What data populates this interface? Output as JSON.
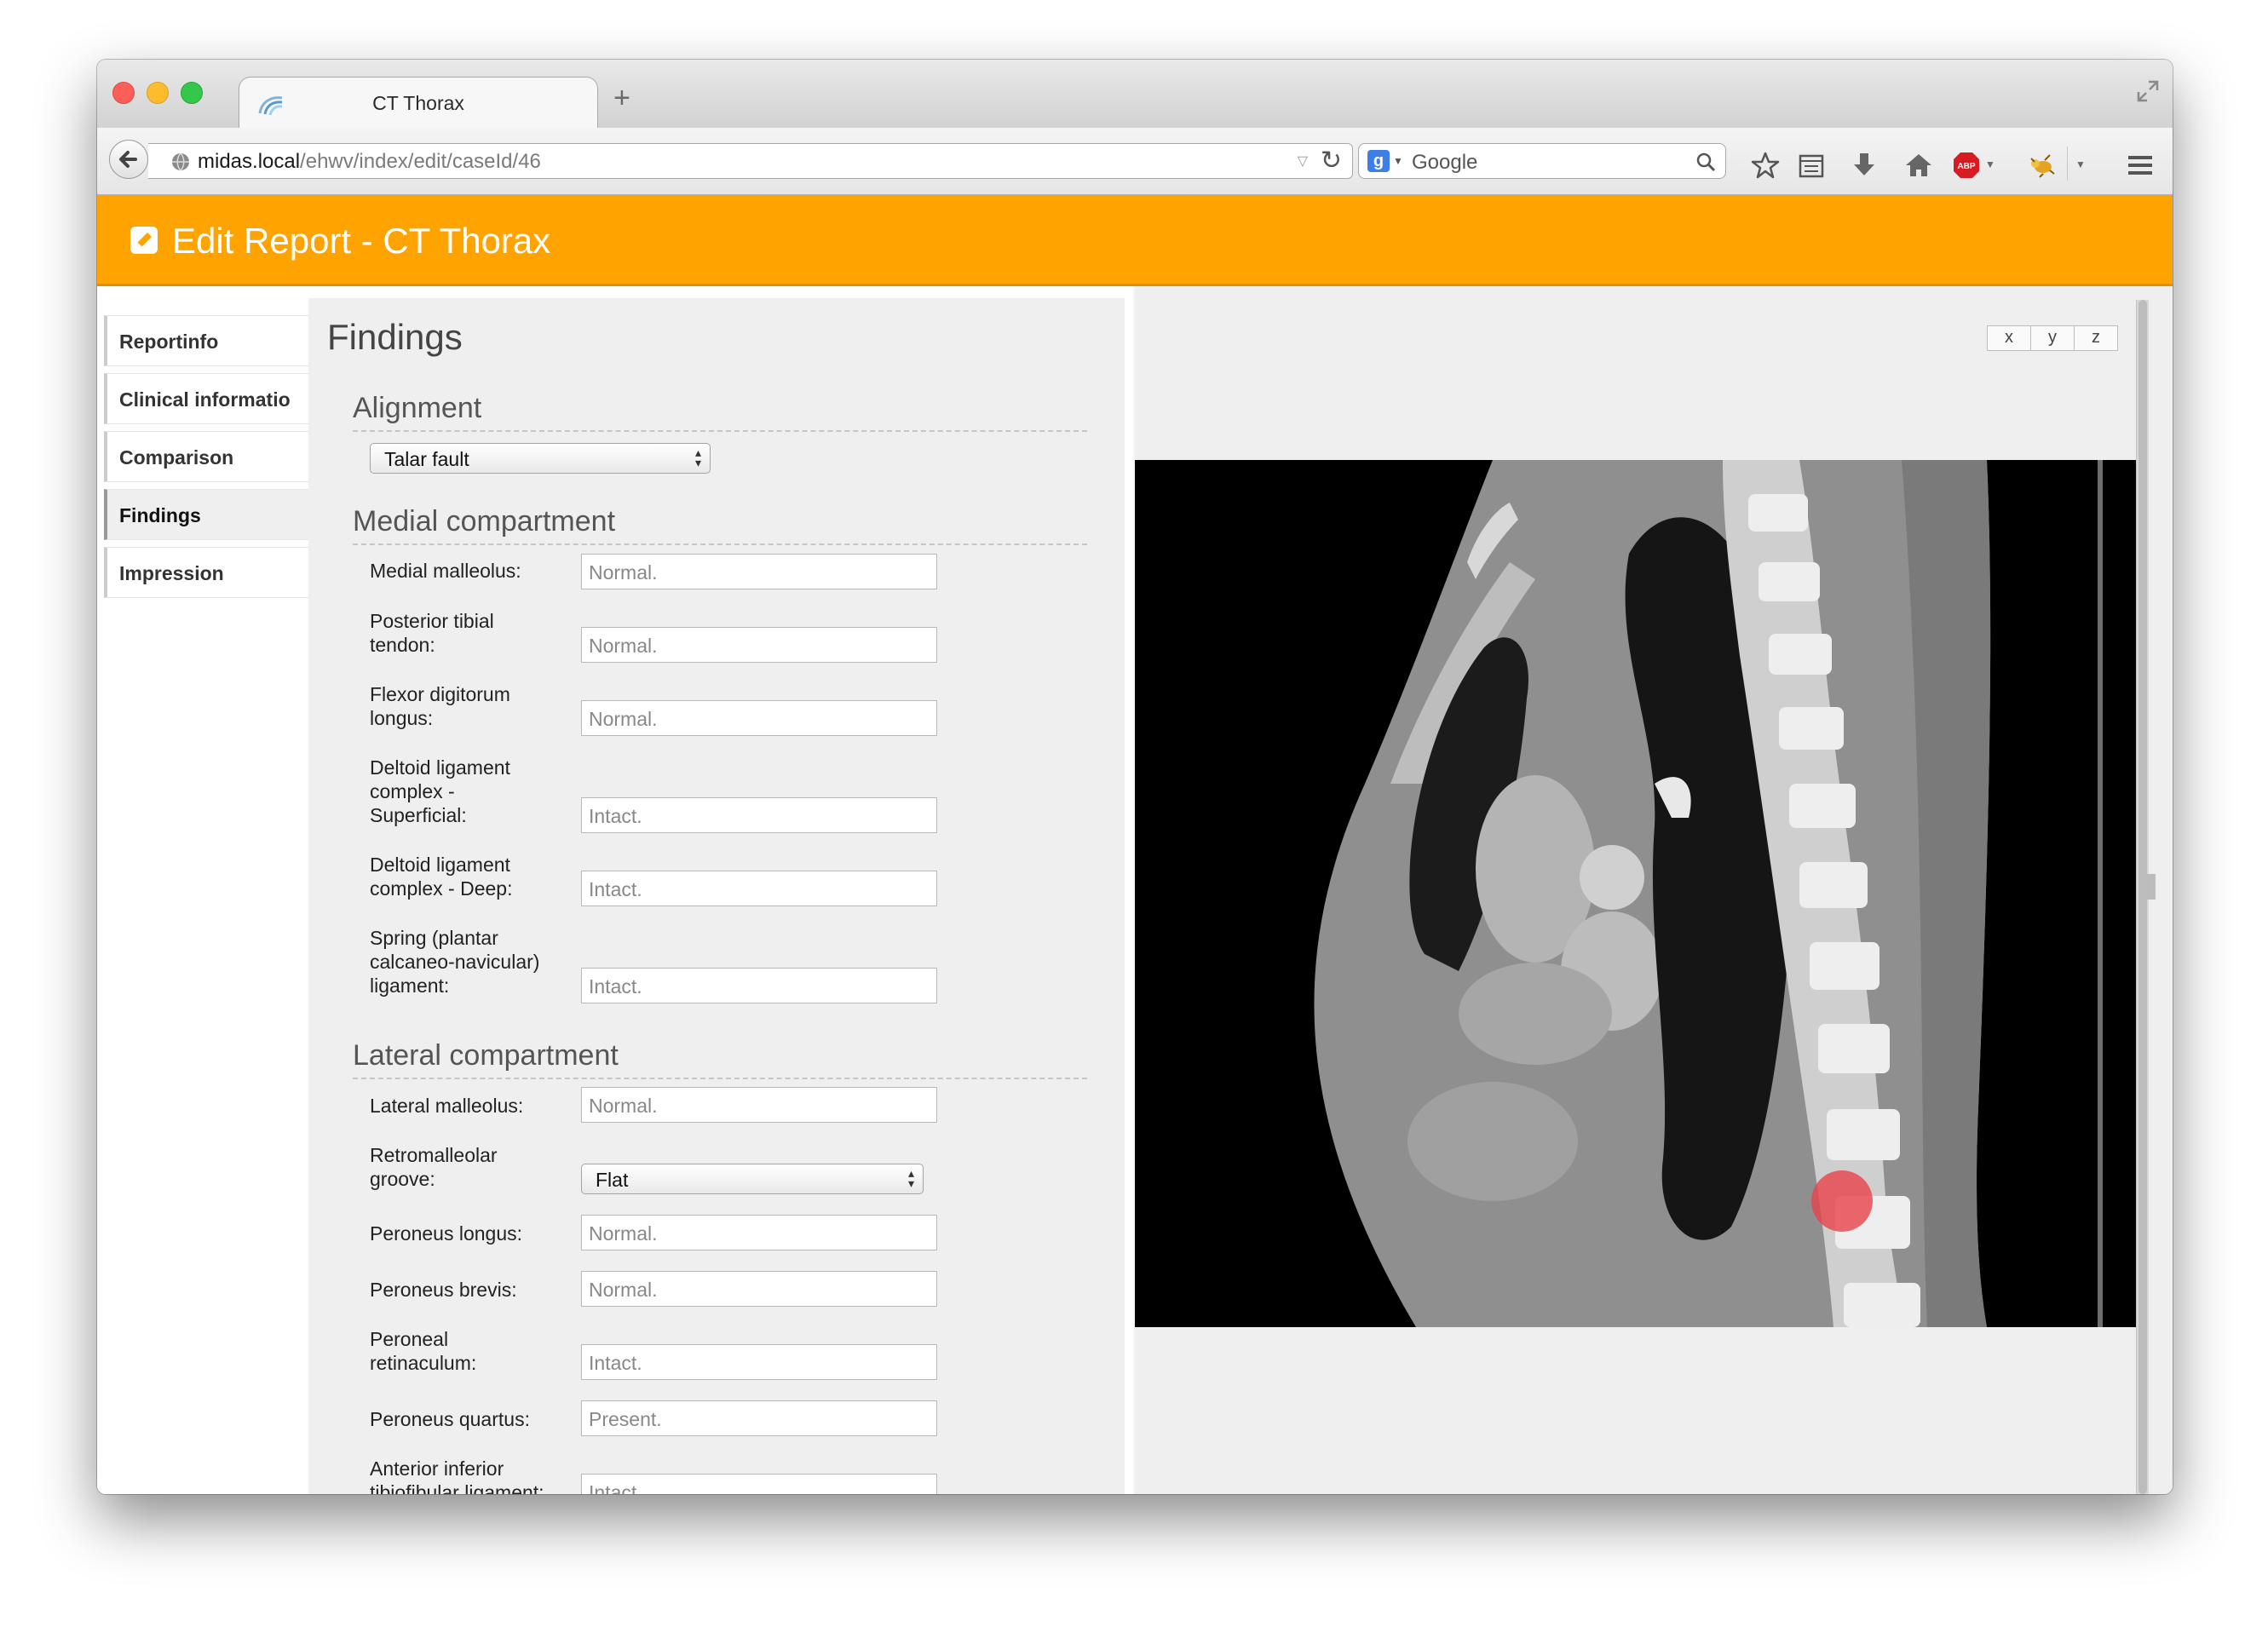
{
  "browser": {
    "tab_title": "CT Thorax",
    "url_host": "midas.local",
    "url_path": "/ehwv/index/edit/caseId/46",
    "search_placeholder": "Google",
    "search_engine_glyph": "g",
    "adblock_label": "ABP"
  },
  "header": {
    "title": "Edit Report - CT Thorax",
    "background": "#ffa300"
  },
  "sidenav": {
    "items": [
      {
        "label": "Reportinfo"
      },
      {
        "label": "Clinical informatio"
      },
      {
        "label": "Comparison"
      },
      {
        "label": "Findings"
      },
      {
        "label": "Impression"
      }
    ],
    "active_index": 3
  },
  "findings": {
    "title": "Findings",
    "alignment": {
      "heading": "Alignment",
      "selected": "Talar fault"
    },
    "medial": {
      "heading": "Medial compartment",
      "fields": [
        {
          "label": "Medial malleolus:",
          "placeholder": "Normal."
        },
        {
          "label": "Posterior tibial tendon:",
          "placeholder": "Normal."
        },
        {
          "label": "Flexor digitorum longus:",
          "placeholder": "Normal."
        },
        {
          "label": "Deltoid ligament complex - Superficial:",
          "placeholder": "Intact."
        },
        {
          "label": "Deltoid ligament complex - Deep:",
          "placeholder": "Intact."
        },
        {
          "label": "Spring (plantar calcaneo-navicular) ligament:",
          "placeholder": "Intact."
        }
      ]
    },
    "lateral": {
      "heading": "Lateral compartment",
      "fields": [
        {
          "label": "Lateral malleolus:",
          "placeholder": "Normal."
        },
        {
          "label": "Retromalleolar groove:",
          "selected": "Flat"
        },
        {
          "label": "Peroneus longus:",
          "placeholder": "Normal."
        },
        {
          "label": "Peroneus brevis:",
          "placeholder": "Normal."
        },
        {
          "label": "Peroneal retinaculum:",
          "placeholder": "Intact."
        },
        {
          "label": "Peroneus quartus:",
          "placeholder": "Present."
        },
        {
          "label": "Anterior inferior tibiofibular ligament:",
          "placeholder": "Intact."
        }
      ]
    }
  },
  "viewer": {
    "axis_buttons": [
      "x",
      "y",
      "z"
    ],
    "marker_color": "#e8424a"
  }
}
